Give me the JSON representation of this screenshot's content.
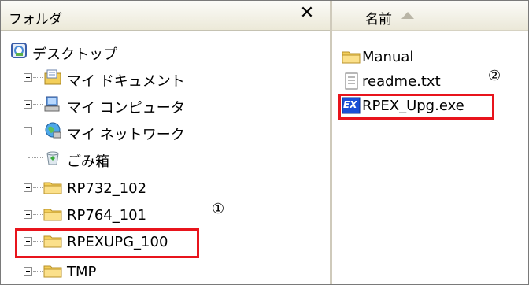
{
  "folder_pane": {
    "title": "フォルダ",
    "close_label": "✕",
    "tree": {
      "desktop": "デスクトップ",
      "my_documents": "マイ ドキュメント",
      "my_computer": "マイ コンピュータ",
      "my_network": "マイ ネットワーク",
      "recycle_bin": "ごみ箱",
      "folders": [
        "RP732_102",
        "RP764_101",
        "RPEXUPG_100",
        "TMP"
      ]
    },
    "annotation_1": "①"
  },
  "file_pane": {
    "column_name": "名前",
    "files": [
      {
        "name": "Manual",
        "icon": "folder-icon"
      },
      {
        "name": "readme.txt",
        "icon": "text-file-icon"
      },
      {
        "name": "RPEX_Upg.exe",
        "icon": "exe-icon"
      }
    ],
    "annotation_2": "②",
    "exe_badge": "EX"
  },
  "colors": {
    "highlight": "#e8141c",
    "folder": "#f3cf5b",
    "selection": "#1a4fd6"
  }
}
